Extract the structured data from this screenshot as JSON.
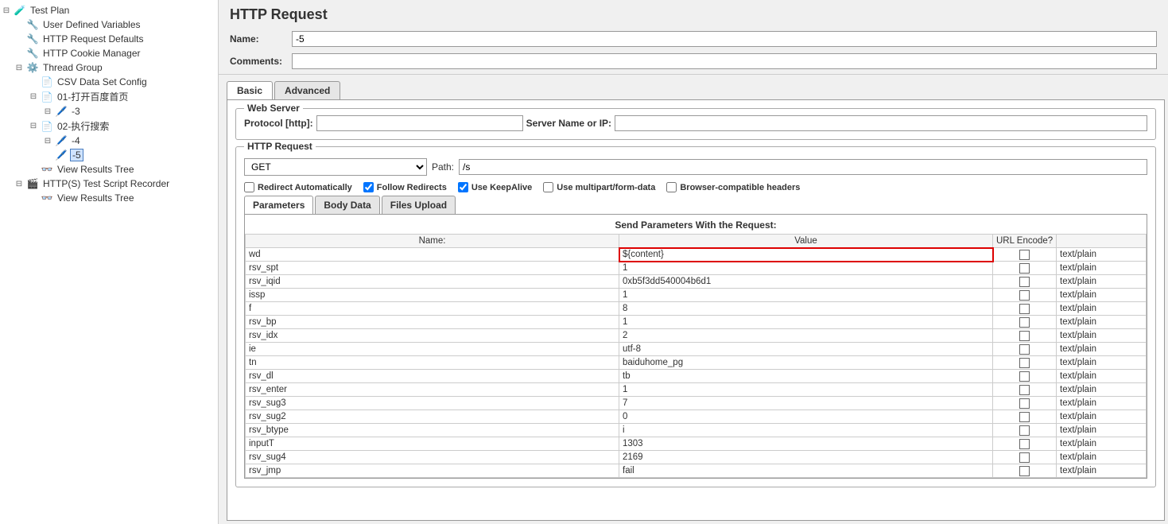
{
  "tree": {
    "root": "Test Plan",
    "udv": "User Defined Variables",
    "hrd": "HTTP Request Defaults",
    "hcm": "HTTP Cookie Manager",
    "tg": "Thread Group",
    "csv": "CSV Data Set Config",
    "sampler1": "01-打开百度首页",
    "s1c1": "-3",
    "sampler2": "02-执行搜索",
    "s2c1": "-4",
    "s2c2": "-5",
    "vrt1": "View Results Tree",
    "rec": "HTTP(S) Test Script Recorder",
    "vrt2": "View Results Tree"
  },
  "main": {
    "title": "HTTP Request",
    "name_label": "Name:",
    "name_value": "-5",
    "comments_label": "Comments:",
    "comments_value": ""
  },
  "tabs": {
    "basic": "Basic",
    "advanced": "Advanced"
  },
  "webserver": {
    "legend": "Web Server",
    "protocol_label": "Protocol [http]:",
    "protocol_value": "",
    "servername_label": "Server Name or IP:",
    "servername_value": ""
  },
  "httprequest": {
    "legend": "HTTP Request",
    "method": "GET",
    "path_label": "Path:",
    "path_value": "/s"
  },
  "checks": {
    "redirect_auto": "Redirect Automatically",
    "follow": "Follow Redirects",
    "keepalive": "Use KeepAlive",
    "multipart": "Use multipart/form-data",
    "browser_compat": "Browser-compatible headers"
  },
  "subtabs": {
    "params": "Parameters",
    "body": "Body Data",
    "files": "Files Upload"
  },
  "paramsTitle": "Send Parameters With the Request:",
  "colHeaders": {
    "name": "Name:",
    "value": "Value",
    "encode": "URL Encode?"
  },
  "contentTypeDefault": "text/plain",
  "params": [
    {
      "name": "wd",
      "value": "${content}",
      "highlight": true
    },
    {
      "name": "rsv_spt",
      "value": "1"
    },
    {
      "name": "rsv_iqid",
      "value": "0xb5f3dd540004b6d1"
    },
    {
      "name": "issp",
      "value": "1"
    },
    {
      "name": "f",
      "value": "8"
    },
    {
      "name": "rsv_bp",
      "value": "1"
    },
    {
      "name": "rsv_idx",
      "value": "2"
    },
    {
      "name": "ie",
      "value": "utf-8"
    },
    {
      "name": "tn",
      "value": "baiduhome_pg"
    },
    {
      "name": "rsv_dl",
      "value": "tb"
    },
    {
      "name": "rsv_enter",
      "value": "1"
    },
    {
      "name": "rsv_sug3",
      "value": "7"
    },
    {
      "name": "rsv_sug2",
      "value": "0"
    },
    {
      "name": "rsv_btype",
      "value": "i"
    },
    {
      "name": "inputT",
      "value": "1303"
    },
    {
      "name": "rsv_sug4",
      "value": "2169"
    },
    {
      "name": "rsv_jmp",
      "value": "fail"
    }
  ]
}
